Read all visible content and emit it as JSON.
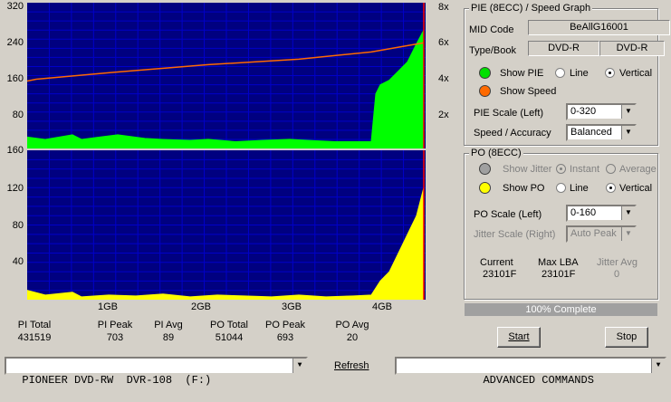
{
  "colors": {
    "plot_bg": "#000080",
    "grid": "#0000c8",
    "pie": "#00ff00",
    "po": "#ffff00",
    "speed": "#ff6a00",
    "marker": "#ff0000"
  },
  "pie_chart": {
    "y_ticks_left": [
      "320",
      "240",
      "160",
      "80"
    ],
    "y_ticks_right": [
      "8x",
      "6x",
      "4x",
      "2x"
    ]
  },
  "po_chart": {
    "y_ticks_left": [
      "160",
      "120",
      "80",
      "40"
    ],
    "x_ticks": [
      "1GB",
      "2GB",
      "3GB",
      "4GB"
    ]
  },
  "chart_data": [
    {
      "type": "area",
      "title": "PIE (8ECC)",
      "ylim": [
        0,
        320
      ],
      "xlim_gb": [
        0,
        4.38
      ],
      "series": [
        {
          "name": "PIE",
          "x": [
            0,
            0.2,
            0.5,
            0.6,
            0.8,
            1.0,
            1.3,
            1.5,
            1.8,
            2.0,
            2.3,
            2.6,
            2.9,
            3.1,
            3.4,
            3.7,
            3.8,
            3.85,
            3.9,
            4.0,
            4.1,
            4.2,
            4.3,
            4.38
          ],
          "y": [
            25,
            20,
            30,
            20,
            25,
            30,
            22,
            20,
            18,
            20,
            15,
            18,
            20,
            18,
            15,
            15,
            15,
            120,
            140,
            150,
            170,
            190,
            230,
            260
          ]
        },
        {
          "name": "Speed",
          "x": [
            0,
            0.1,
            1.0,
            2.0,
            3.0,
            3.8,
            4.38
          ],
          "y": [
            3.7,
            3.8,
            4.2,
            4.6,
            4.9,
            5.3,
            5.8
          ]
        }
      ]
    },
    {
      "type": "area",
      "title": "PO (8ECC)",
      "ylim": [
        0,
        160
      ],
      "xlim_gb": [
        0,
        4.38
      ],
      "series": [
        {
          "name": "PO",
          "x": [
            0,
            0.2,
            0.5,
            0.6,
            0.9,
            1.2,
            1.5,
            1.8,
            2.1,
            2.4,
            2.7,
            3.0,
            3.3,
            3.6,
            3.8,
            3.9,
            4.0,
            4.1,
            4.2,
            4.3,
            4.38
          ],
          "y": [
            10,
            5,
            8,
            3,
            5,
            4,
            6,
            3,
            5,
            4,
            3,
            5,
            3,
            4,
            5,
            20,
            30,
            50,
            70,
            90,
            120
          ]
        }
      ]
    }
  ],
  "stats": [
    {
      "label": "PI Total",
      "value": "431519"
    },
    {
      "label": "PI Peak",
      "value": "703"
    },
    {
      "label": "PI Avg",
      "value": "89"
    },
    {
      "label": "PO Total",
      "value": "51044"
    },
    {
      "label": "PO Peak",
      "value": "693"
    },
    {
      "label": "PO Avg",
      "value": "20"
    }
  ],
  "pie_panel": {
    "title": "PIE (8ECC) / Speed Graph",
    "mid_label": "MID Code",
    "mid_value": "BeAllG16001",
    "type_label": "Type/Book",
    "type_value": "DVD-R",
    "book_value": "DVD-R",
    "show_pie": "Show PIE",
    "line": "Line",
    "vertical": "Vertical",
    "show_speed": "Show Speed",
    "scale_label": "PIE Scale (Left)",
    "scale_value": "0-320",
    "speed_label": "Speed / Accuracy",
    "speed_value": "Balanced"
  },
  "po_panel": {
    "title": "PO (8ECC)",
    "show_jitter": "Show Jitter",
    "instant": "Instant",
    "average": "Average",
    "show_po": "Show PO",
    "line": "Line",
    "vertical": "Vertical",
    "scale_label": "PO Scale (Left)",
    "scale_value": "0-160",
    "jitter_label": "Jitter Scale (Right)",
    "jitter_value": "Auto Peak",
    "current_label": "Current",
    "current_value": "23101F",
    "maxlba_label": "Max LBA",
    "maxlba_value": "23101F",
    "jitteravg_label": "Jitter Avg",
    "jitteravg_value": "0"
  },
  "progress_text": "100% Complete",
  "start_button": "Start",
  "stop_button": "Stop",
  "drive": "PIONEER DVD-RW  DVR-108  (F:)",
  "refresh": "Refresh",
  "advanced": "ADVANCED COMMANDS"
}
